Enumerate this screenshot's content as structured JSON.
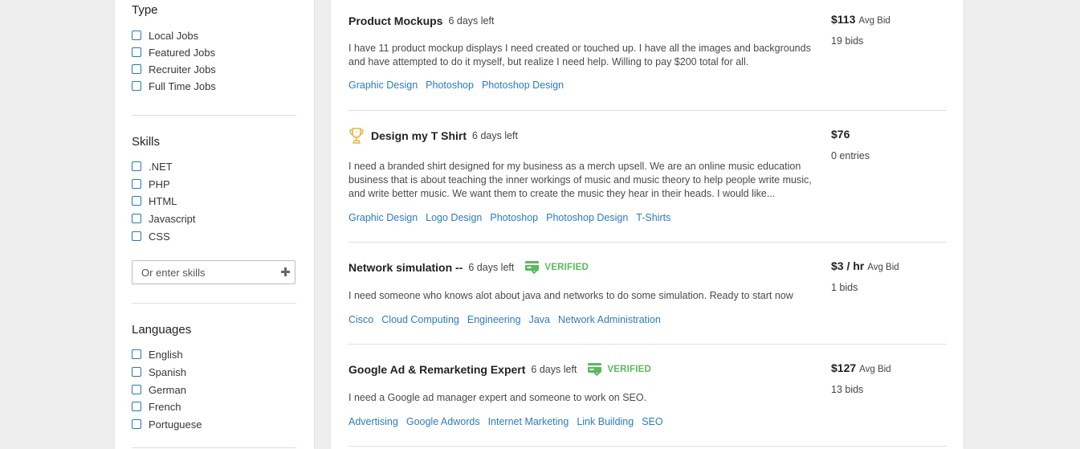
{
  "filters": {
    "type": {
      "title": "Type",
      "items": [
        "Local Jobs",
        "Featured Jobs",
        "Recruiter Jobs",
        "Full Time Jobs"
      ]
    },
    "skills": {
      "title": "Skills",
      "items": [
        ".NET",
        "PHP",
        "HTML",
        "Javascript",
        "CSS"
      ],
      "input_placeholder": "Or enter skills"
    },
    "languages": {
      "title": "Languages",
      "items": [
        "English",
        "Spanish",
        "German",
        "French",
        "Portuguese"
      ]
    }
  },
  "jobs": [
    {
      "title": "Product Mockups",
      "time_left": "6 days left",
      "description": "I have 11 product mockup displays I need created or touched up. I have all the images and backgrounds and have attempted to do it myself, but realize I need help. Willing to pay $200 total for all.",
      "tags": [
        "Graphic Design",
        "Photoshop",
        "Photoshop Design"
      ],
      "price": "$113",
      "price_label": "Avg Bid",
      "count": "19 bids"
    },
    {
      "title": "Design my T Shirt",
      "time_left": "6 days left",
      "description": "I need a branded shirt designed for my business as a merch upsell. We are an online music education business that is about teaching the inner workings of music and music theory to help people write music, and write better music. We want them to create the music they hear in their heads. I would like...",
      "tags": [
        "Graphic Design",
        "Logo Design",
        "Photoshop",
        "Photoshop Design",
        "T-Shirts"
      ],
      "price": "$76",
      "price_label": "",
      "count": "0 entries"
    },
    {
      "title": "Network simulation --",
      "time_left": "6 days left",
      "verified": "VERIFIED",
      "description": "I need someone who knows alot about java and networks to do some simulation. Ready to start now",
      "tags": [
        "Cisco",
        "Cloud Computing",
        "Engineering",
        "Java",
        "Network Administration"
      ],
      "price": "$3 / hr",
      "price_label": "Avg Bid",
      "count": "1 bids"
    },
    {
      "title": "Google Ad & Remarketing Expert",
      "time_left": "6 days left",
      "verified": "VERIFIED",
      "description": "I need a Google ad manager expert and someone to work on SEO.",
      "tags": [
        "Advertising",
        "Google Adwords",
        "Internet Marketing",
        "Link Building",
        "SEO"
      ],
      "price": "$127",
      "price_label": "Avg Bid",
      "count": "13 bids"
    }
  ],
  "colors": {
    "link": "#2b7bbf",
    "checkbox_border": "#2a77b8",
    "verified": "#5cb85c",
    "trophy": "#e2b648"
  },
  "icons": {
    "contest": "trophy-icon",
    "verified": "verified-payment-icon",
    "add": "plus-icon"
  }
}
